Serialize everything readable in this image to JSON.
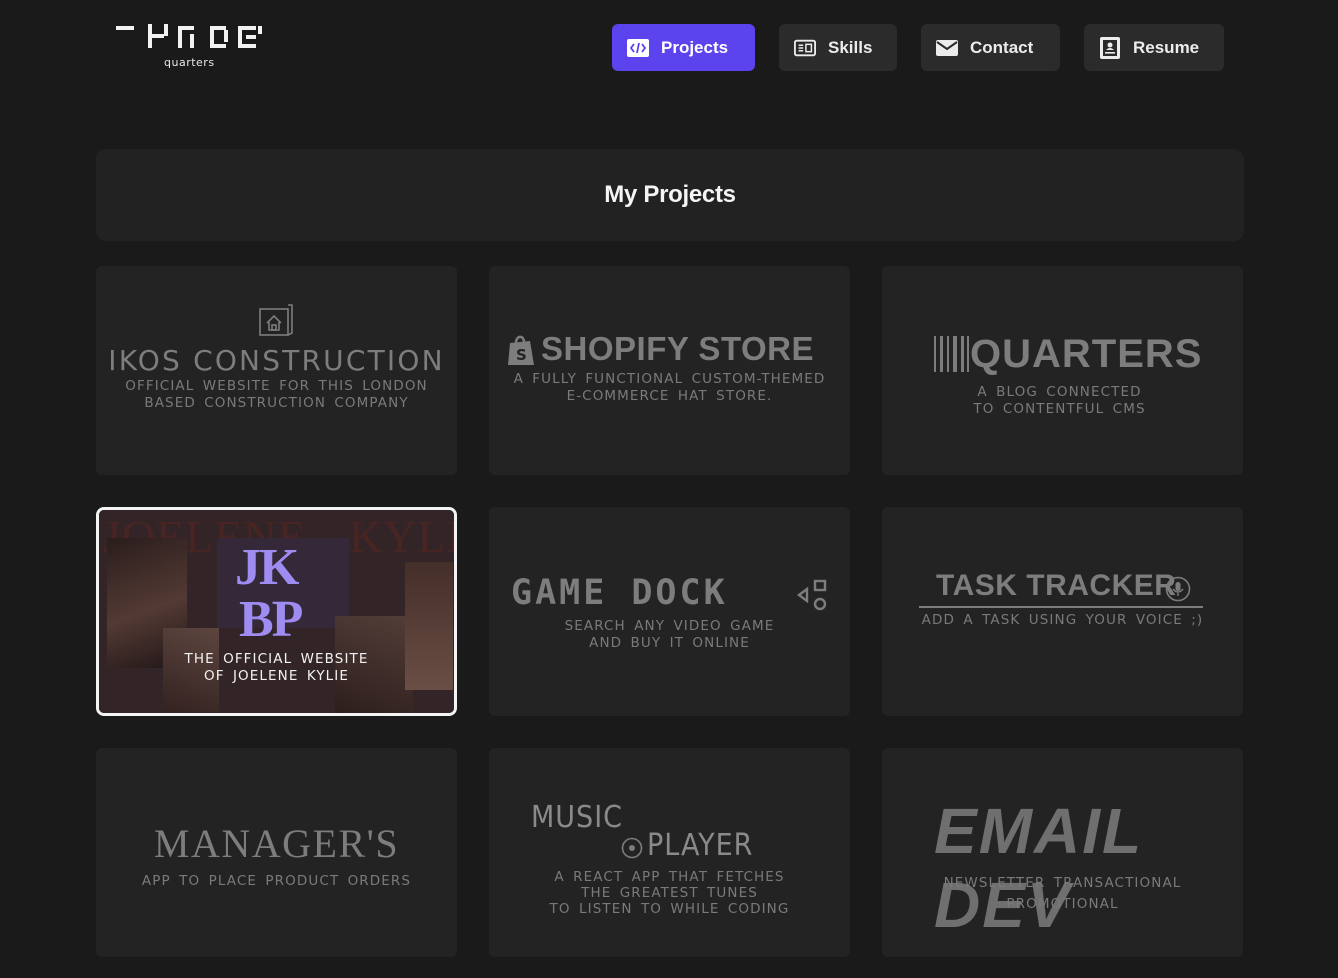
{
  "brand": {
    "logo_text": "THREE",
    "sub": "quarters"
  },
  "nav": [
    {
      "label": "Projects",
      "icon": "code-icon",
      "active": true
    },
    {
      "label": "Skills",
      "icon": "skills-icon",
      "active": false
    },
    {
      "label": "Contact",
      "icon": "mail-icon",
      "active": false
    },
    {
      "label": "Resume",
      "icon": "resume-icon",
      "active": false
    }
  ],
  "page_title": "My Projects",
  "projects": [
    {
      "title": "IKOS CONSTRUCTION",
      "desc": "OFFICIAL WEBSITE FOR THIS LONDON\nBASED CONSTRUCTION COMPANY",
      "icon": "blueprint-icon"
    },
    {
      "title": "SHOPIFY STORE",
      "desc": "A FULLY FUNCTIONAL CUSTOM-THEMED\nE-COMMERCE HAT STORE.",
      "icon": "shopify-bag-icon"
    },
    {
      "title": "QUARTERS",
      "desc": "A BLOG CONNECTED\nTO CONTENTFUL CMS",
      "icon": "barcode-icon"
    },
    {
      "title": "JK BP",
      "bg_text_left": "JOELENE",
      "bg_text_right": "KYLIE",
      "monogram_1": "JK",
      "monogram_2": "BP",
      "desc": "THE OFFICIAL WEBSITE\nOF JOELENE KYLIE"
    },
    {
      "title": "GAME DOCK",
      "desc": "SEARCH ANY VIDEO GAME\nAND BUY IT ONLINE",
      "icon": "controller-buttons-icon"
    },
    {
      "title": "TASK TRACKER",
      "desc": "ADD A TASK USING YOUR VOICE ;)",
      "icon": "microphone-icon"
    },
    {
      "title": "MANAGER'S",
      "desc": "APP TO PLACE PRODUCT ORDERS",
      "icon": "star-icon"
    },
    {
      "title_1": "MUSIC",
      "title_2": "PLAYER",
      "desc": "A REACT APP THAT FETCHES\nTHE GREATEST TUNES\nTO LISTEN TO WHILE CODING",
      "icon": "vinyl-icon"
    },
    {
      "title": "EMAIL DEV",
      "desc": "NEWSLETTER   TRANSACTIONAL\nPROMOTIONAL"
    }
  ],
  "colors": {
    "accent": "#5b43ee",
    "card": "#232323",
    "muted_text": "#7d7d7d",
    "monogram": "#9e8cf0"
  }
}
